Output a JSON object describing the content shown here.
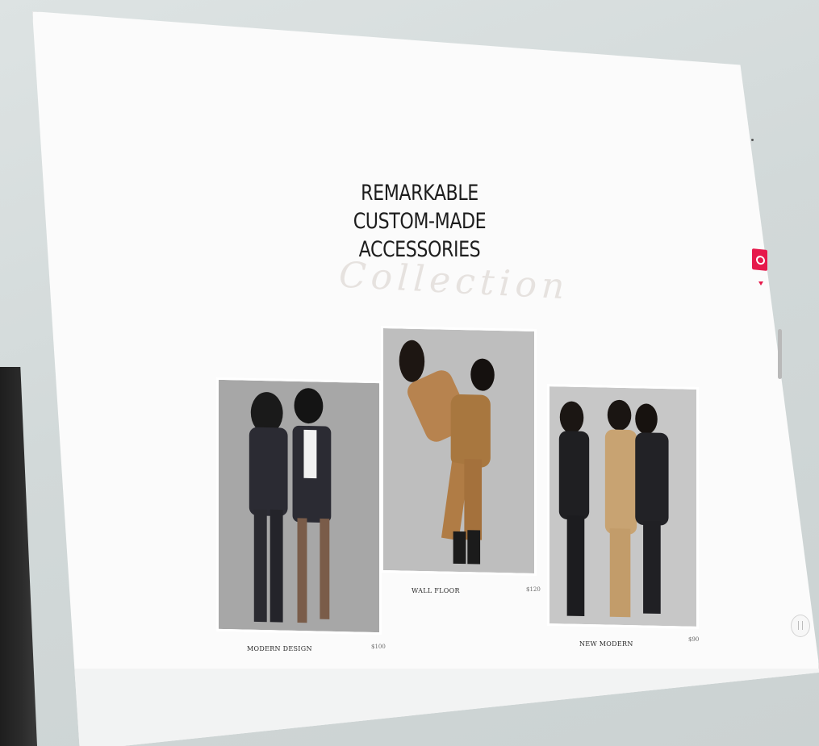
{
  "hero": {
    "headline_lines": [
      "REMARKABLE",
      "CUSTOM-MADE",
      "ACCESSORIES"
    ],
    "script_word": "Collection"
  },
  "products": [
    {
      "name": "MODERN DESIGN",
      "price": "$100"
    },
    {
      "name": "WALL FLOOR",
      "price": "$120"
    },
    {
      "name": "NEW MODERN",
      "price": "$90"
    }
  ],
  "colors": {
    "accent": "#e6194b",
    "background": "#fbfbfb",
    "text": "#1d1d1d"
  },
  "icons": {
    "badge": "gift-icon",
    "chat": "chat-icon"
  }
}
